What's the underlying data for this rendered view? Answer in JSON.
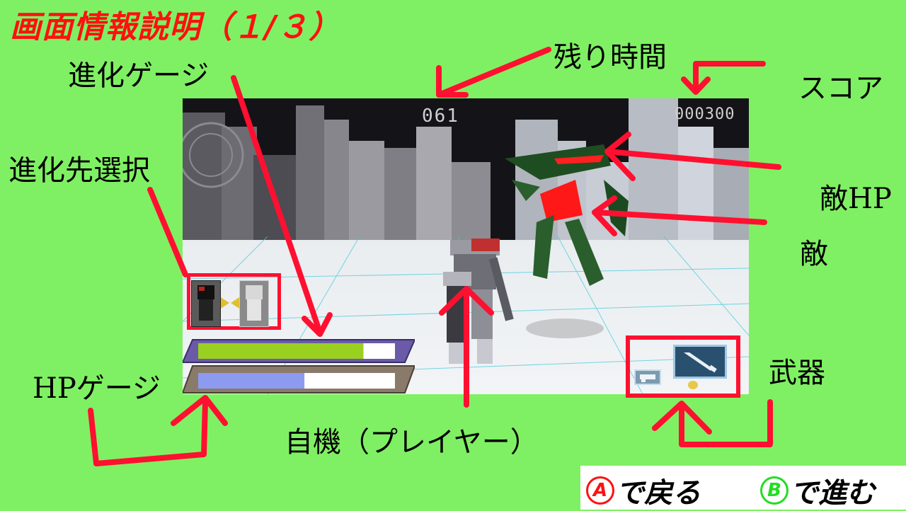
{
  "title": "画面情報説明（１/３）",
  "labels": {
    "remaining_time": "残り時間",
    "score": "スコア",
    "evolution_gauge": "進化ゲージ",
    "evolution_select": "進化先選択",
    "enemy_hp": "敵HP",
    "enemy": "敵",
    "weapon": "武器",
    "hp_gauge": "HPゲージ",
    "player": "自機（プレイヤー）"
  },
  "hud": {
    "time": "061",
    "score": "000300",
    "evolution_gauge_fill": 0.84,
    "hp_fill": 0.54
  },
  "nav": {
    "back_key": "A",
    "back_label": "で戻る",
    "next_key": "B",
    "next_label": "で進む"
  },
  "colors": {
    "background": "#7ff063",
    "accent_red": "#ff1030",
    "title_red": "#ff1010",
    "key_a": "#ff1010",
    "key_b": "#22dd22"
  }
}
